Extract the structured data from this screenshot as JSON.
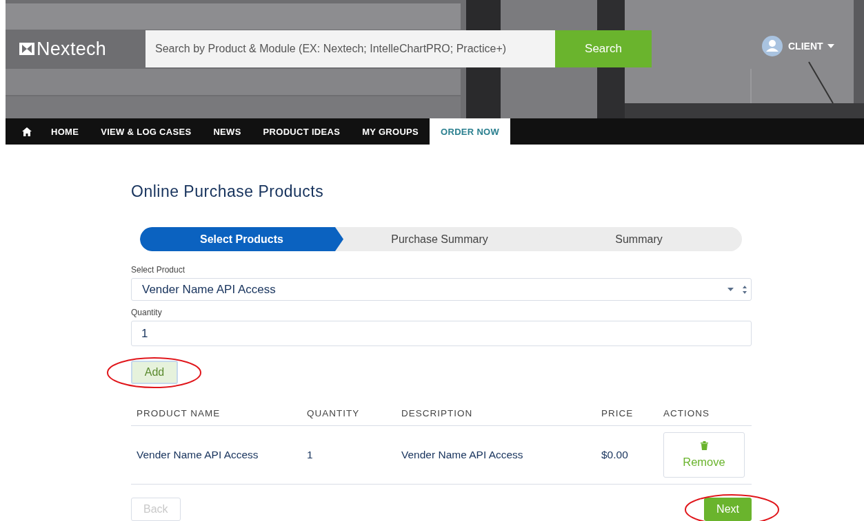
{
  "header": {
    "logo": "Nextech",
    "search": {
      "placeholder": "Search by Product & Module (EX: Nextech; IntelleChartPRO; Practice+)"
    },
    "search_button": "Search",
    "user": "CLIENT"
  },
  "nav": [
    {
      "label": "HOME",
      "selected": false
    },
    {
      "label": "VIEW & LOG CASES",
      "selected": false
    },
    {
      "label": "NEWS",
      "selected": false
    },
    {
      "label": "PRODUCT IDEAS",
      "selected": false
    },
    {
      "label": "MY GROUPS",
      "selected": false
    },
    {
      "label": "ORDER NOW",
      "selected": true
    }
  ],
  "page_title": "Online Purchase Products",
  "steps": [
    {
      "label": "Select Products",
      "selected": true
    },
    {
      "label": "Purchase Summary",
      "selected": false
    },
    {
      "label": "Summary",
      "selected": false
    }
  ],
  "form": {
    "product_label": "Select Product",
    "product_value": "Vender Name API Access",
    "quantity_label": "Quantity",
    "quantity_value": "1"
  },
  "add_button": {
    "label": "Add",
    "circled": true
  },
  "table": {
    "columns": [
      "PRODUCT NAME",
      "QUANTITY",
      "DESCRIPTION",
      "PRICE",
      "ACTIONS"
    ],
    "rows": [
      {
        "product_name": "Vender Name API Access",
        "quantity": "1",
        "description": "Vender Name API Access",
        "price": "$0.00",
        "action": "Remove"
      }
    ]
  },
  "back_button": {
    "label": "Back",
    "disabled": true,
    "circled": false
  },
  "next_button": {
    "label": "Next",
    "disabled": false,
    "circled": true
  }
}
